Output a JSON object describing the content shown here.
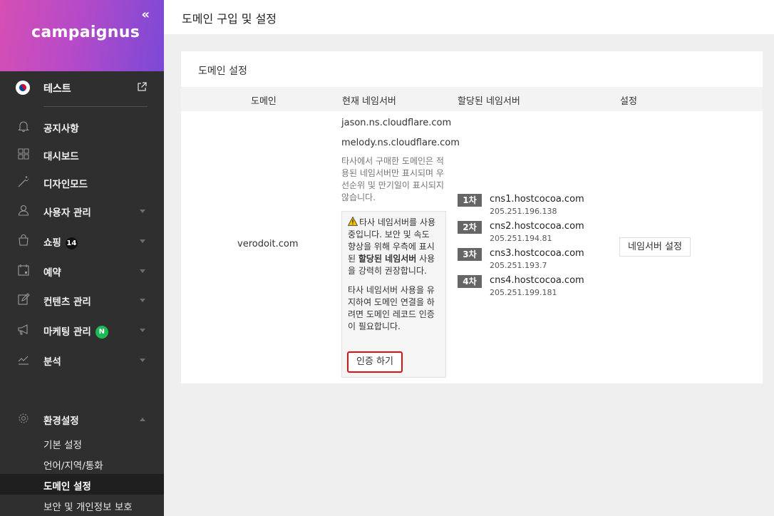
{
  "sidebar": {
    "logo": "campaignus",
    "collapse_icon": "«",
    "site_name": "테스트",
    "nav": [
      {
        "label": "공지사항",
        "icon": "bell-icon"
      },
      {
        "label": "대시보드",
        "icon": "grid-icon"
      },
      {
        "label": "디자인모드",
        "icon": "magic-wand-icon"
      },
      {
        "label": "사용자 관리",
        "icon": "user-icon"
      },
      {
        "label": "쇼핑",
        "icon": "shopping-bag-icon",
        "badge": "14"
      },
      {
        "label": "예약",
        "icon": "calendar-icon"
      },
      {
        "label": "컨텐츠 관리",
        "icon": "edit-icon"
      },
      {
        "label": "마케팅 관리",
        "icon": "megaphone-icon",
        "badge": "N"
      },
      {
        "label": "분석",
        "icon": "chart-icon"
      },
      {
        "label": "환경설정",
        "icon": "gear-icon"
      }
    ],
    "settings_sub": [
      "기본 설정",
      "언어/지역/통화",
      "도메인 설정",
      "보안 및 개인정보 보호"
    ]
  },
  "header": {
    "title": "도메인 구입 및 설정"
  },
  "card": {
    "title": "도메인 설정",
    "columns": [
      "도메인",
      "현재 네임서버",
      "할당된 네임서버",
      "설정"
    ],
    "domain": "verodoit.com",
    "current_ns": [
      "jason.ns.cloudflare.com",
      "melody.ns.cloudflare.com"
    ],
    "current_note": "타사에서 구매한 도메인은 적용된 네임서버만 표시되며 우선순위 및 만기일이 표시되지 않습니다.",
    "warning": {
      "pre": "타사 네임서버를 사용 중입니다. 보안 및 속도 향상을 위해 우측에 표시된 ",
      "bold": "할당된 네임서버",
      "post": " 사용을 강력히 권장합니다.",
      "second": "타사 네임서버 사용을 유지하여 도메인 연결을 하려면 도메인 레코드 인증이 필요합니다.",
      "button": "인증 하기"
    },
    "assigned_ns": [
      {
        "rank": "1차",
        "host": "cns1.hostcocoa.com",
        "ip": "205.251.196.138"
      },
      {
        "rank": "2차",
        "host": "cns2.hostcocoa.com",
        "ip": "205.251.194.81"
      },
      {
        "rank": "3차",
        "host": "cns3.hostcocoa.com",
        "ip": "205.251.193.7"
      },
      {
        "rank": "4차",
        "host": "cns4.hostcocoa.com",
        "ip": "205.251.199.181"
      }
    ],
    "settings_button": "네임서버 설정"
  }
}
